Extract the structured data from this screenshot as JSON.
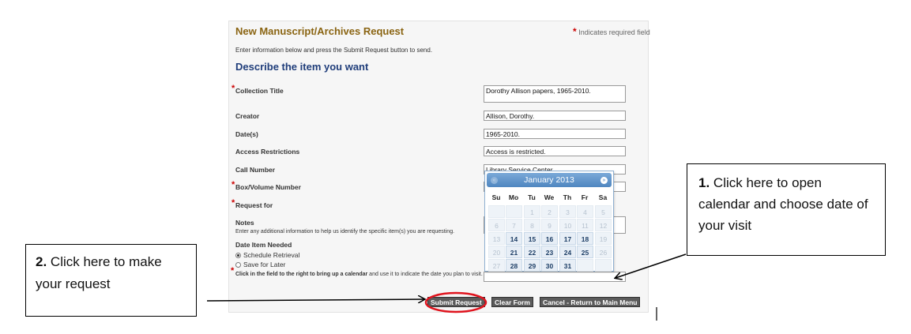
{
  "form": {
    "title": "New Manuscript/Archives Request",
    "required_star": "*",
    "required_note": "Indicates required field",
    "instructions": "Enter information below and press the Submit Request button to send.",
    "section_title": "Describe the item you want"
  },
  "fields": {
    "collection_title": {
      "label": "Collection Title",
      "value": "Dorothy Allison papers, 1965-2010."
    },
    "creator": {
      "label": "Creator",
      "value": "Allison, Dorothy."
    },
    "dates": {
      "label": "Date(s)",
      "value": "1965-2010."
    },
    "access": {
      "label": "Access Restrictions",
      "value": "Access is restricted."
    },
    "call_number": {
      "label": "Call Number",
      "value": "Library Service Center"
    },
    "box_volume": {
      "label": "Box/Volume Number",
      "value": ""
    },
    "request_for": {
      "label": "Request for",
      "value": ""
    },
    "notes": {
      "label": "Notes",
      "help": "Enter any additional information to help us identify the specific item(s) you are requesting.",
      "value": ""
    },
    "date_needed": {
      "label": "Date Item Needed",
      "options": [
        "Schedule Retrieval",
        "Save for Later"
      ],
      "selected": "Schedule Retrieval"
    },
    "visit_date": {
      "hint_bold": "Click in the field to the right to bring up a calendar",
      "hint_rest": " and use it to indicate the date you plan to visit.",
      "value": ""
    }
  },
  "calendar": {
    "month_label": "January 2013",
    "prev_icon": "«",
    "next_icon": "»",
    "weekdays": [
      "Su",
      "Mo",
      "Tu",
      "We",
      "Th",
      "Fr",
      "Sa"
    ],
    "weeks": [
      [
        null,
        null,
        "1",
        "2",
        "3",
        "4",
        "5"
      ],
      [
        "6",
        "7",
        "8",
        "9",
        "10",
        "11",
        "12"
      ],
      [
        "13",
        "14",
        "15",
        "16",
        "17",
        "18",
        "19"
      ],
      [
        "20",
        "21",
        "22",
        "23",
        "24",
        "25",
        "26"
      ],
      [
        "27",
        "28",
        "29",
        "30",
        "31",
        null,
        null
      ]
    ],
    "selectable": [
      "14",
      "15",
      "16",
      "17",
      "18",
      "21",
      "22",
      "23",
      "24",
      "25",
      "28",
      "29",
      "30",
      "31"
    ]
  },
  "buttons": {
    "submit": "Submit Request",
    "clear": "Clear Form",
    "cancel": "Cancel - Return to Main Menu"
  },
  "callouts": {
    "c1_num": "1.",
    "c1_text": " Click here to open calendar and choose date of your visit",
    "c2_num": "2.",
    "c2_text": " Click here to make your request"
  },
  "colors": {
    "title": "#8a6412",
    "section": "#1f3d7a",
    "required": "#cc0000",
    "calendar_header": "#4f86c0",
    "highlight_ring": "#e0141e"
  }
}
